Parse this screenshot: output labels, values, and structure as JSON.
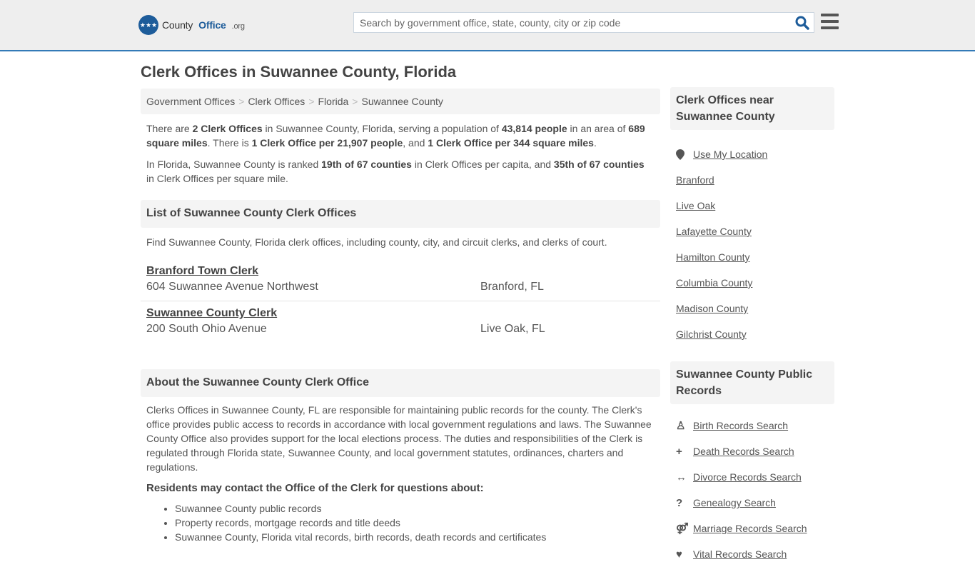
{
  "header": {
    "logo": {
      "county": "County",
      "office": "Office",
      "org": ".org"
    },
    "search_placeholder": "Search by government office, state, county, city or zip code",
    "search_value": "",
    "colors": {
      "accent": "#337ab7",
      "brand": "#1d5c9a",
      "background": "#eeeeee"
    }
  },
  "page": {
    "title": "Clerk Offices in Suwannee County, Florida"
  },
  "breadcrumb": [
    {
      "label": "Government Offices"
    },
    {
      "label": "Clerk Offices"
    },
    {
      "label": "Florida"
    },
    {
      "label": "Suwannee County"
    }
  ],
  "summary": {
    "p1": {
      "t1": "There are ",
      "b1": "2 Clerk Offices",
      "t2": " in Suwannee County, Florida, serving a population of ",
      "b2": "43,814 people",
      "t3": " in an area of ",
      "b3": "689 square miles",
      "t4": ". There is ",
      "b4": "1 Clerk Office per 21,907 people",
      "t5": ", and ",
      "b5": "1 Clerk Office per 344 square miles",
      "t6": "."
    },
    "p2": {
      "t1": "In Florida, Suwannee County is ranked ",
      "b1": "19th of 67 counties",
      "t2": " in Clerk Offices per capita, and ",
      "b2": "35th of 67 counties",
      "t3": " in Clerk Offices per square mile."
    }
  },
  "list_section": {
    "heading": "List of Suwannee County Clerk Offices",
    "intro": "Find Suwannee County, Florida clerk offices, including county, city, and circuit clerks, and clerks of court.",
    "offices": [
      {
        "name": "Branford Town Clerk",
        "address": "604 Suwannee Avenue Northwest",
        "city": "Branford, FL"
      },
      {
        "name": "Suwannee County Clerk",
        "address": "200 South Ohio Avenue",
        "city": "Live Oak, FL"
      }
    ]
  },
  "about_section": {
    "heading": "About the Suwannee County Clerk Office",
    "text": "Clerks Offices in Suwannee County, FL are responsible for maintaining public records for the county. The Clerk's office provides public access to records in accordance with local government regulations and laws. The Suwannee County Office also provides support for the local elections process. The duties and responsibilities of the Clerk is regulated through Florida state, Suwannee County, and local government statutes, ordinances, charters and regulations.",
    "contact_heading": "Residents may contact the Office of the Clerk for questions about:",
    "contact_items": [
      "Suwannee County public records",
      "Property records, mortgage records and title deeds",
      "Suwannee County, Florida vital records, birth records, death records and certificates"
    ]
  },
  "sidebar": {
    "nearby": {
      "heading": "Clerk Offices near Suwannee County",
      "use_location": {
        "label": "Use My Location",
        "icon": "map-marker-icon"
      },
      "links": [
        "Branford",
        "Live Oak",
        "Lafayette County",
        "Hamilton County",
        "Columbia County",
        "Madison County",
        "Gilchrist County"
      ]
    },
    "records": {
      "heading": "Suwannee County Public Records",
      "links": [
        {
          "label": "Birth Records Search",
          "icon": "child-icon",
          "glyph": "♙"
        },
        {
          "label": "Death Records Search",
          "icon": "plus-icon",
          "glyph": "+"
        },
        {
          "label": "Divorce Records Search",
          "icon": "arrows-h-icon",
          "glyph": "↔"
        },
        {
          "label": "Genealogy Search",
          "icon": "question-icon",
          "glyph": "?"
        },
        {
          "label": "Marriage Records Search",
          "icon": "venus-mars-icon",
          "glyph": "⚤"
        },
        {
          "label": "Vital Records Search",
          "icon": "heartbeat-icon",
          "glyph": "♥"
        }
      ]
    }
  }
}
